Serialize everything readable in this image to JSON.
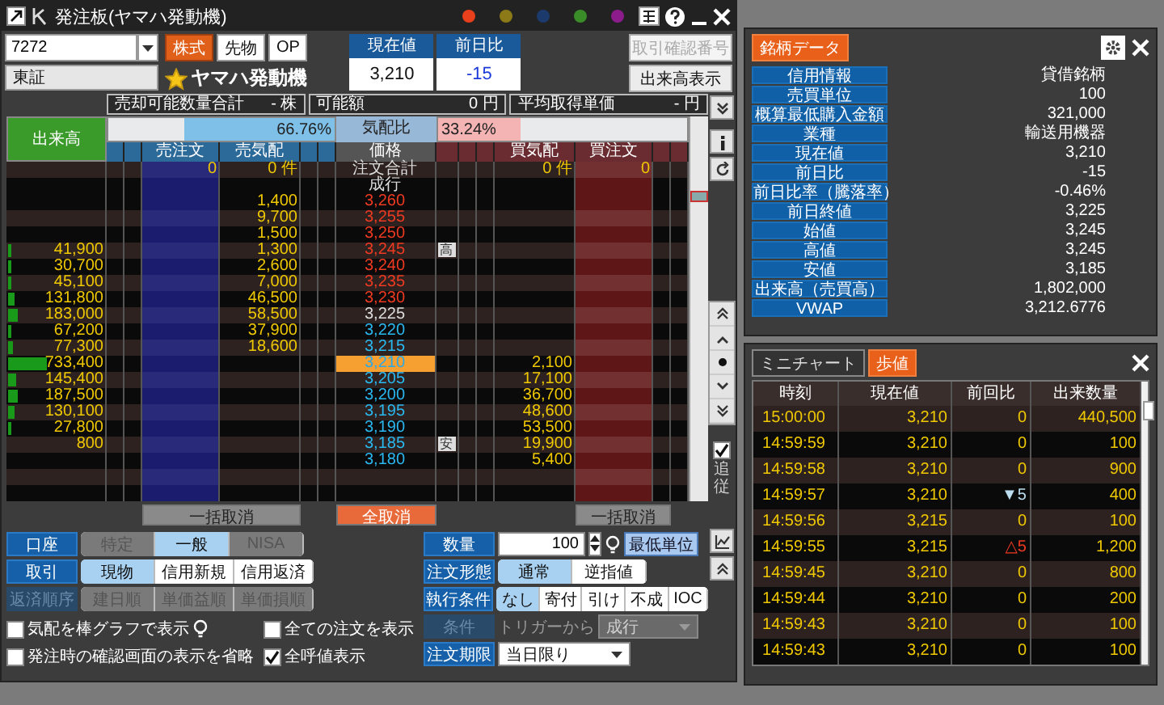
{
  "window": {
    "title": "発注板(ヤマハ発動機)",
    "color_dots": [
      {
        "color": "#e8401c"
      },
      {
        "color": "#8c7a18"
      },
      {
        "color": "#1c3a6c"
      },
      {
        "color": "#3a8c28"
      },
      {
        "color": "#8c1c8c"
      }
    ]
  },
  "symbol": {
    "code": "7272",
    "market_types": [
      {
        "label": "株式",
        "selected": true
      },
      {
        "label": "先物",
        "selected": false
      },
      {
        "label": "OP",
        "selected": false
      }
    ],
    "exchange": "東証",
    "name": "ヤマハ発動機",
    "favorite": true
  },
  "quote": {
    "price_label": "現在値",
    "price": "3,210",
    "change_label": "前日比",
    "change": "-15"
  },
  "top_buttons": [
    {
      "label": "取引確認番号",
      "disabled": true
    },
    {
      "label": "出来高表示",
      "disabled": false
    }
  ],
  "position_info": [
    {
      "label": "売却可能数量合計",
      "value": "- 株"
    },
    {
      "label": "可能額",
      "value": "0 円"
    },
    {
      "label": "平均取得単価",
      "value": "- 円"
    }
  ],
  "book": {
    "volume_header": "出来高",
    "ratio": {
      "label": "気配比",
      "sell": {
        "text": "66.76%",
        "level": 0.6676
      },
      "buy": {
        "text": "33.24%",
        "level": 0.3324
      }
    },
    "columns": [
      "売注文",
      "売気配",
      "価格",
      "買気配",
      "買注文"
    ],
    "totals": {
      "sell_orders": "0",
      "sell_count": "0 件",
      "label": "注文合計",
      "buy_count": "0 件",
      "buy_orders": "0"
    },
    "market_order": "成行",
    "rows": [
      {
        "sell": "1,400",
        "price": "3,260",
        "kind": "up"
      },
      {
        "sell": "9,700",
        "price": "3,255",
        "kind": "up"
      },
      {
        "sell": "1,500",
        "price": "3,250",
        "kind": "up"
      },
      {
        "volume": "41,900",
        "level": 0.023,
        "sell": "1,300",
        "price": "3,245",
        "kind": "up",
        "mark": "高"
      },
      {
        "volume": "30,700",
        "level": 0.017,
        "sell": "2,600",
        "price": "3,240",
        "kind": "up"
      },
      {
        "volume": "45,100",
        "level": 0.025,
        "sell": "7,000",
        "price": "3,235",
        "kind": "up"
      },
      {
        "volume": "131,800",
        "level": 0.072,
        "sell": "46,500",
        "price": "3,230",
        "kind": "up"
      },
      {
        "volume": "183,000",
        "level": 0.1,
        "sell": "58,500",
        "price": "3,225",
        "kind": "flat"
      },
      {
        "volume": "67,200",
        "level": 0.037,
        "sell": "37,900",
        "price": "3,220",
        "kind": "down"
      },
      {
        "volume": "77,300",
        "level": 0.042,
        "sell": "18,600",
        "price": "3,215",
        "kind": "down"
      },
      {
        "volume": "733,400",
        "level": 0.4,
        "price": "3,210",
        "kind": "current",
        "buy": "2,100"
      },
      {
        "volume": "145,400",
        "level": 0.079,
        "price": "3,205",
        "kind": "down",
        "buy": "17,100"
      },
      {
        "volume": "187,500",
        "level": 0.102,
        "price": "3,200",
        "kind": "down",
        "buy": "36,700"
      },
      {
        "volume": "130,100",
        "level": 0.071,
        "price": "3,195",
        "kind": "down",
        "buy": "48,600"
      },
      {
        "volume": "27,800",
        "level": 0.015,
        "price": "3,190",
        "kind": "down",
        "buy": "53,500"
      },
      {
        "volume": "800",
        "price": "3,185",
        "kind": "down",
        "mark": "安",
        "buy": "19,900"
      },
      {
        "price": "3,180",
        "kind": "down",
        "buy": "5,400"
      }
    ]
  },
  "cancel_buttons": [
    {
      "label": "一括取消",
      "kind": "sell"
    },
    {
      "label": "全取消",
      "kind": "all"
    },
    {
      "label": "一括取消",
      "kind": "buy"
    }
  ],
  "left_form": [
    {
      "label": "口座",
      "disabled": false,
      "options": [
        {
          "label": "特定",
          "selected": false,
          "disabled": true
        },
        {
          "label": "一般",
          "selected": true,
          "disabled": false
        },
        {
          "label": "NISA",
          "selected": false,
          "disabled": true
        }
      ]
    },
    {
      "label": "取引",
      "disabled": false,
      "options": [
        {
          "label": "現物",
          "selected": true,
          "disabled": false
        },
        {
          "label": "信用新規",
          "selected": false,
          "disabled": false
        },
        {
          "label": "信用返済",
          "selected": false,
          "disabled": false
        }
      ]
    },
    {
      "label": "返済順序",
      "disabled": true,
      "options": [
        {
          "label": "建日順",
          "selected": false,
          "disabled": true
        },
        {
          "label": "単価益順",
          "selected": false,
          "disabled": true
        },
        {
          "label": "単価損順",
          "selected": false,
          "disabled": true
        }
      ]
    }
  ],
  "checkboxes": [
    {
      "label": "気配を棒グラフで表示",
      "checked": false,
      "hint": true
    },
    {
      "label": "全ての注文を表示",
      "checked": false,
      "hint": false
    },
    {
      "label": "発注時の確認画面の表示を省略",
      "checked": false,
      "hint": false
    },
    {
      "label": "全呼値表示",
      "checked": true,
      "hint": false
    }
  ],
  "side": {
    "follow_label": "追従",
    "follow_checked": true
  },
  "right_form": {
    "quantity": {
      "label": "数量",
      "value": "100",
      "unit_button": "最低単位"
    },
    "order_type": {
      "label": "注文形態",
      "options": [
        {
          "label": "通常",
          "selected": true
        },
        {
          "label": "逆指値",
          "selected": false
        }
      ]
    },
    "execution": {
      "label": "執行条件",
      "options": [
        {
          "label": "なし",
          "selected": true
        },
        {
          "label": "寄付",
          "selected": false
        },
        {
          "label": "引け",
          "selected": false
        },
        {
          "label": "不成",
          "selected": false
        },
        {
          "label": "IOC",
          "selected": false
        }
      ]
    },
    "condition": {
      "label": "条件",
      "disabled": true,
      "trigger_label": "トリガーから",
      "value": "成行"
    },
    "expiry": {
      "label": "注文期限",
      "value": "当日限り"
    }
  },
  "stock_data": {
    "tabs": [
      {
        "label": "銘柄データ",
        "selected": true
      }
    ],
    "rows": [
      {
        "label": "信用情報",
        "value": "貸借銘柄"
      },
      {
        "label": "売買単位",
        "value": "100"
      },
      {
        "label": "概算最低購入金額",
        "value": "321,000"
      },
      {
        "label": "業種",
        "value": "輸送用機器"
      },
      {
        "label": "現在値",
        "value": "3,210"
      },
      {
        "label": "前日比",
        "value": "-15"
      },
      {
        "label": "前日比率（騰落率）",
        "value": "-0.46%"
      },
      {
        "label": "前日終値",
        "value": "3,225"
      },
      {
        "label": "始値",
        "value": "3,245"
      },
      {
        "label": "高値",
        "value": "3,245"
      },
      {
        "label": "安値",
        "value": "3,185"
      },
      {
        "label": "出来高（売買高）",
        "value": "1,802,000"
      },
      {
        "label": "VWAP",
        "value": "3,212.6776"
      }
    ]
  },
  "ticks": {
    "tabs": [
      {
        "label": "ミニチャート",
        "selected": false
      },
      {
        "label": "歩値",
        "selected": true
      }
    ],
    "columns": [
      "時刻",
      "現在値",
      "前回比",
      "出来数量"
    ],
    "rows": [
      {
        "time": "15:00:00",
        "price": "3,210",
        "change": "0",
        "kind": "flat",
        "volume": "440,500"
      },
      {
        "time": "14:59:59",
        "price": "3,210",
        "change": "0",
        "kind": "flat",
        "volume": "100"
      },
      {
        "time": "14:59:58",
        "price": "3,210",
        "change": "0",
        "kind": "flat",
        "volume": "900"
      },
      {
        "time": "14:59:57",
        "price": "3,210",
        "change": "▼5",
        "kind": "down",
        "volume": "400"
      },
      {
        "time": "14:59:56",
        "price": "3,215",
        "change": "0",
        "kind": "flat",
        "volume": "100"
      },
      {
        "time": "14:59:55",
        "price": "3,215",
        "change": "△5",
        "kind": "up",
        "volume": "1,200"
      },
      {
        "time": "14:59:45",
        "price": "3,210",
        "change": "0",
        "kind": "flat",
        "volume": "800"
      },
      {
        "time": "14:59:44",
        "price": "3,210",
        "change": "0",
        "kind": "flat",
        "volume": "200"
      },
      {
        "time": "14:59:43",
        "price": "3,210",
        "change": "0",
        "kind": "flat",
        "volume": "100"
      },
      {
        "time": "14:59:43",
        "price": "3,210",
        "change": "0",
        "kind": "flat",
        "volume": "100"
      }
    ]
  }
}
